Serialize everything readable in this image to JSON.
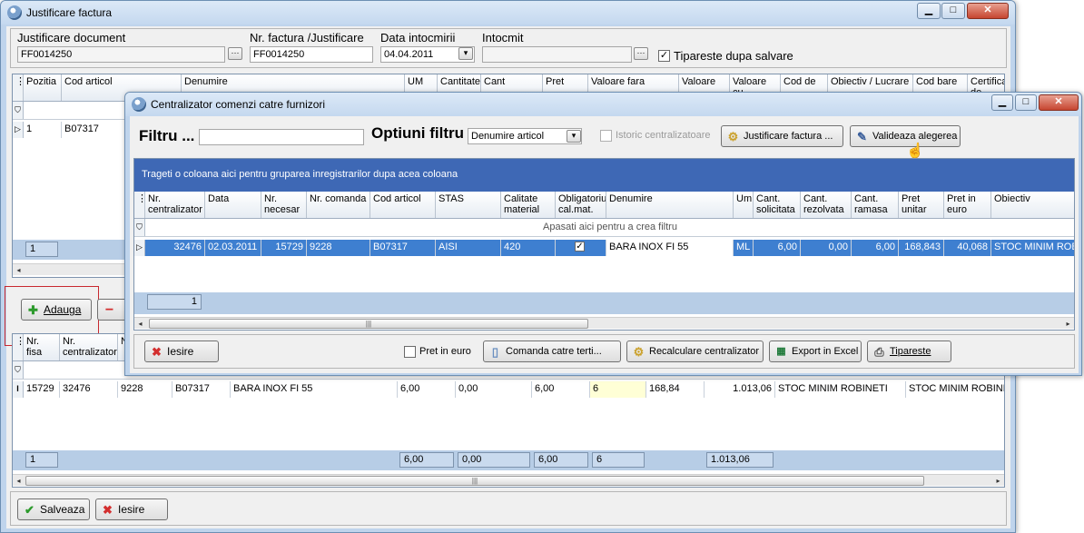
{
  "main_window": {
    "title": "Justificare factura",
    "caption_buttons": {
      "minimize": "▁",
      "maximize": "□",
      "close": "✕"
    },
    "fields": {
      "justificare_document": {
        "label": "Justificare document",
        "value": "FF0014250"
      },
      "nr_factura": {
        "label": "Nr. factura /Justificare",
        "value": "FF0014250"
      },
      "data_intocmirii": {
        "label": "Data intocmirii",
        "value": "04.04.2011"
      },
      "intocmit": {
        "label": "Intocmit",
        "value": ""
      },
      "tipareste": {
        "label": "Tipareste dupa salvare",
        "checked": true
      }
    },
    "top_grid": {
      "headers": [
        "Pozitia",
        "Cod articol",
        "Denumire",
        "UM",
        "Cantitate",
        "Cant",
        "Pret",
        "Valoare fara",
        "Valoare",
        "Valoare cu",
        "Cod de",
        "Obiectiv / Lucrare",
        "Cod bare",
        "Certificat de"
      ],
      "rows": [
        {
          "pozitia": "1",
          "cod_articol": "B07317"
        }
      ],
      "footer_count": "1"
    },
    "buttons": {
      "adauga": "Adauga",
      "remove": "−"
    },
    "bottom_grid": {
      "headers": [
        "Nr. fisa",
        "Nr. centralizator",
        "N"
      ],
      "row": [
        "15729",
        "32476",
        "9228",
        "B07317",
        "BARA INOX FI 55",
        "6,00",
        "0,00",
        "6,00",
        "6",
        "168,84",
        "1.013,06",
        "STOC MINIM ROBINETI",
        "STOC MINIM ROBINE"
      ],
      "footer": {
        "count": "1",
        "v1": "6,00",
        "v2": "0,00",
        "v3": "6,00",
        "v4": "6",
        "v5": "1.013,06"
      }
    },
    "bottom_buttons": {
      "salveaza": "Salveaza",
      "iesire": "Iesire"
    }
  },
  "dialog": {
    "title": "Centralizator comenzi catre furnizori",
    "filter_label": "Filtru ...",
    "filter_value": "",
    "options_label": "Optiuni filtru",
    "options_value": "Denumire articol",
    "istoric_label": "Istoric centralizatoare",
    "justificare_button": "Justificare factura ...",
    "valideaza_button": "Valideaza alegerea",
    "group_banner": "Trageti o coloana aici pentru gruparea inregistrarilor dupa acea coloana",
    "headers": [
      "Nr. centralizator",
      "Data",
      "Nr. necesar",
      "Nr. comanda",
      "Cod articol",
      "STAS",
      "Calitate material",
      "Obligatoriu cal.mat.",
      "Denumire",
      "Um",
      "Cant. solicitata",
      "Cant. rezolvata",
      "Cant. ramasa",
      "Pret unitar",
      "Pret in euro",
      "Obiectiv"
    ],
    "filter_hint": "Apasati aici pentru a  crea filtru",
    "row": {
      "nr_centralizator": "32476",
      "data": "02.03.2011",
      "nr_necesar": "15729",
      "nr_comanda": "9228",
      "cod_articol": "B07317",
      "stas": "AISI",
      "calitate": "420",
      "obligatoriu": true,
      "denumire": "BARA INOX FI 55",
      "um": "ML",
      "cant_solicitata": "6,00",
      "cant_rezolvata": "0,00",
      "cant_ramasa": "6,00",
      "pret_unitar": "168,843",
      "pret_euro": "40,068",
      "obiectiv": "STOC MINIM ROB"
    },
    "footer_count": "1",
    "bottom": {
      "iesire": "Iesire",
      "pret_euro": "Pret in euro",
      "comanda": "Comanda catre terti...",
      "recalculare": "Recalculare centralizator",
      "export": "Export in Excel",
      "tipareste": "Tipareste"
    }
  }
}
